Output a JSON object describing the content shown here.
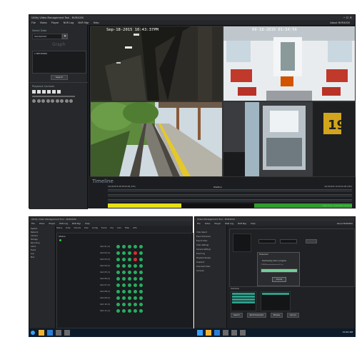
{
  "top_window": {
    "title": "Utility Video Management Tool - NVR4000",
    "menu": [
      "File",
      "Video",
      "Player",
      "NVR Log",
      "NVR Mgr",
      "Help"
    ],
    "user": "About NVR4000"
  },
  "left_panel": {
    "date_label": "Select Date",
    "date_value": "09/18/2015",
    "graph_label": "Graph",
    "list_header": "1 NETWORK",
    "go_button": "Search",
    "controls_label": "Playback Controls"
  },
  "cameras": [
    {
      "timestamp": "Sep-18-2015  10:43:37PM",
      "scene": "tunnel"
    },
    {
      "timestamp": "09-18-2015  01:54:56",
      "scene": "car-interior"
    },
    {
      "timestamp": "",
      "scene": "track-outside"
    },
    {
      "timestamp": "",
      "scene": "cab-door"
    }
  ],
  "timeline": {
    "title": "Timeline",
    "center_label": "Position",
    "left_time": "12/13/2015 09:58:58 AM (UTC)",
    "right_time": "12/13/2015 10:20:54 AM (UTC)",
    "bands": [
      {
        "color": "#e8e012",
        "fraction": 0.3
      },
      {
        "color": "#111111",
        "fraction": 0.3
      },
      {
        "color": "#2e9e2e",
        "fraction": 0.4
      }
    ],
    "footer": "Data Time: 12/13/2015 10:20:54"
  },
  "bottom_left": {
    "title": "Utility Video Management Tool - NVR4000",
    "menu": [
      "File",
      "Video",
      "Player",
      "NVR Log",
      "NVR Mgr",
      "Help"
    ],
    "tabs": [
      "Status",
      "Date",
      "Volume",
      "Disk",
      "Config",
      "Event",
      "Pos",
      "Cam",
      "Filter",
      "GPS"
    ],
    "list_title": "Status",
    "tree": [
      "System",
      "Network",
      "Camera",
      "Storage",
      "Recording",
      "Alarm",
      "Event",
      "Log",
      "Misc"
    ],
    "row_labels": [
      "Cam 01 (1)",
      "Cam 02 (1)",
      "Cam 03 (1)",
      "Cam 04 (1)",
      "Cam 05 (1)",
      "Cam 06 (1)",
      "Cam 07 (1)",
      "Cam 08 (1)",
      "Cam 09 (1)",
      "Cam 10 (1)",
      "Cam 11 (1)"
    ]
  },
  "bottom_right": {
    "title": "Video Management Tool - NVR4000",
    "menu": [
      "File",
      "Video",
      "Player",
      "NVR Log",
      "NVR Mgr",
      "Help"
    ],
    "user": "About NVR4000",
    "dialog_title": "Download",
    "dialog_text": "Downloading video in progress",
    "dialog_path": "C:\\NVR\\download\\camera01.avi",
    "dialog_button": "Cancel",
    "left_list": [
      "Video Select",
      "Event Download",
      "Export Video",
      "Video Settings",
      "Camera Settings",
      "Event Log",
      "Playback Review",
      "Snapshot",
      "Download Video",
      "Cameras"
    ],
    "section_label": "Camera",
    "buttons": [
      "Search",
      "Start Download",
      "Browse",
      "Cancel"
    ]
  },
  "taskbar": {
    "clock": "10:22 AM"
  }
}
